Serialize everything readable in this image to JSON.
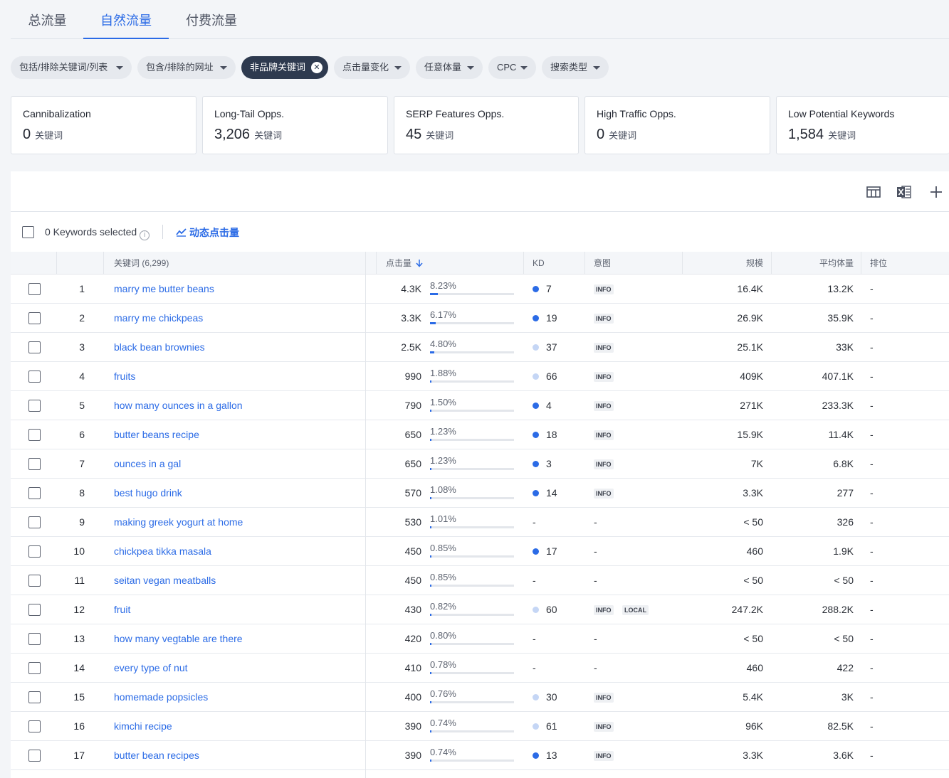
{
  "tabs": [
    {
      "label": "总流量",
      "active": false
    },
    {
      "label": "自然流量",
      "active": true
    },
    {
      "label": "付费流量",
      "active": false
    }
  ],
  "filters": [
    {
      "label": "包括/排除关键词/列表"
    },
    {
      "label": "包含/排除的网址"
    },
    {
      "label": "非品牌关键词",
      "active": true
    },
    {
      "label": "点击量变化"
    },
    {
      "label": "任意体量"
    },
    {
      "label": "CPC"
    },
    {
      "label": "搜索类型"
    }
  ],
  "cards": [
    {
      "title": "Cannibalization",
      "value": "0",
      "unit": "关键词"
    },
    {
      "title": "Long-Tail Opps.",
      "value": "3,206",
      "unit": "关键词"
    },
    {
      "title": "SERP Features Opps.",
      "value": "45",
      "unit": "关键词"
    },
    {
      "title": "High Traffic Opps.",
      "value": "0",
      "unit": "关键词"
    },
    {
      "title": "Low Potential Keywords",
      "value": "1,584",
      "unit": "关键词"
    }
  ],
  "toolbar": {
    "icons": [
      "columns-icon",
      "excel-export-icon",
      "plus-icon"
    ]
  },
  "selection": {
    "text": "0 Keywords selected",
    "info_glyph": "i",
    "dynamic_label": "动态点击量"
  },
  "columns": {
    "keyword": "关键词 (6,299)",
    "clicks": "点击量",
    "kd": "KD",
    "intent": "意图",
    "scale": "规模",
    "avg_volume": "平均体量",
    "rank": "排位"
  },
  "colors": {
    "accent": "#2b6be6",
    "kd_dark": "#2b6be6",
    "kd_light": "#c5d6f5"
  },
  "rows": [
    {
      "n": "1",
      "kw": "marry me butter beans",
      "clicks": "4.3K",
      "pct": "8.23%",
      "share": 0.0823,
      "kd": "7",
      "kd_level": "dark",
      "intent": [
        "INFO"
      ],
      "scale": "16.4K",
      "avg": "13.2K",
      "rank": "-"
    },
    {
      "n": "2",
      "kw": "marry me chickpeas",
      "clicks": "3.3K",
      "pct": "6.17%",
      "share": 0.0617,
      "kd": "19",
      "kd_level": "dark",
      "intent": [
        "INFO"
      ],
      "scale": "26.9K",
      "avg": "35.9K",
      "rank": "-"
    },
    {
      "n": "3",
      "kw": "black bean brownies",
      "clicks": "2.5K",
      "pct": "4.80%",
      "share": 0.048,
      "kd": "37",
      "kd_level": "light",
      "intent": [
        "INFO"
      ],
      "scale": "25.1K",
      "avg": "33K",
      "rank": "-"
    },
    {
      "n": "4",
      "kw": "fruits",
      "clicks": "990",
      "pct": "1.88%",
      "share": 0.0188,
      "kd": "66",
      "kd_level": "light",
      "intent": [
        "INFO"
      ],
      "scale": "409K",
      "avg": "407.1K",
      "rank": "-"
    },
    {
      "n": "5",
      "kw": "how many ounces in a gallon",
      "clicks": "790",
      "pct": "1.50%",
      "share": 0.015,
      "kd": "4",
      "kd_level": "dark",
      "intent": [
        "INFO"
      ],
      "scale": "271K",
      "avg": "233.3K",
      "rank": "-"
    },
    {
      "n": "6",
      "kw": "butter beans recipe",
      "clicks": "650",
      "pct": "1.23%",
      "share": 0.0123,
      "kd": "18",
      "kd_level": "dark",
      "intent": [
        "INFO"
      ],
      "scale": "15.9K",
      "avg": "11.4K",
      "rank": "-"
    },
    {
      "n": "7",
      "kw": "ounces in a gal",
      "clicks": "650",
      "pct": "1.23%",
      "share": 0.0123,
      "kd": "3",
      "kd_level": "dark",
      "intent": [
        "INFO"
      ],
      "scale": "7K",
      "avg": "6.8K",
      "rank": "-"
    },
    {
      "n": "8",
      "kw": "best hugo drink",
      "clicks": "570",
      "pct": "1.08%",
      "share": 0.0108,
      "kd": "14",
      "kd_level": "dark",
      "intent": [
        "INFO"
      ],
      "scale": "3.3K",
      "avg": "277",
      "rank": "-"
    },
    {
      "n": "9",
      "kw": "making greek yogurt at home",
      "clicks": "530",
      "pct": "1.01%",
      "share": 0.0101,
      "kd": "-",
      "kd_level": "none",
      "intent": [],
      "intent_dash": "-",
      "scale": "< 50",
      "avg": "326",
      "rank": "-"
    },
    {
      "n": "10",
      "kw": "chickpea tikka masala",
      "clicks": "450",
      "pct": "0.85%",
      "share": 0.0085,
      "kd": "17",
      "kd_level": "dark",
      "intent": [],
      "intent_dash": "-",
      "scale": "460",
      "avg": "1.9K",
      "rank": "-"
    },
    {
      "n": "11",
      "kw": "seitan vegan meatballs",
      "clicks": "450",
      "pct": "0.85%",
      "share": 0.0085,
      "kd": "-",
      "kd_level": "none",
      "intent": [],
      "intent_dash": "-",
      "scale": "< 50",
      "avg": "< 50",
      "rank": "-"
    },
    {
      "n": "12",
      "kw": "fruit",
      "clicks": "430",
      "pct": "0.82%",
      "share": 0.0082,
      "kd": "60",
      "kd_level": "light",
      "intent": [
        "INFO",
        "LOCAL"
      ],
      "scale": "247.2K",
      "avg": "288.2K",
      "rank": "-"
    },
    {
      "n": "13",
      "kw": "how many vegtable are there",
      "clicks": "420",
      "pct": "0.80%",
      "share": 0.008,
      "kd": "-",
      "kd_level": "none",
      "intent": [],
      "intent_dash": "-",
      "scale": "< 50",
      "avg": "< 50",
      "rank": "-"
    },
    {
      "n": "14",
      "kw": "every type of nut",
      "clicks": "410",
      "pct": "0.78%",
      "share": 0.0078,
      "kd": "-",
      "kd_level": "none",
      "intent": [],
      "intent_dash": "-",
      "scale": "460",
      "avg": "422",
      "rank": "-"
    },
    {
      "n": "15",
      "kw": "homemade popsicles",
      "clicks": "400",
      "pct": "0.76%",
      "share": 0.0076,
      "kd": "30",
      "kd_level": "light",
      "intent": [
        "INFO"
      ],
      "scale": "5.4K",
      "avg": "3K",
      "rank": "-"
    },
    {
      "n": "16",
      "kw": "kimchi recipe",
      "clicks": "390",
      "pct": "0.74%",
      "share": 0.0074,
      "kd": "61",
      "kd_level": "light",
      "intent": [
        "INFO"
      ],
      "scale": "96K",
      "avg": "82.5K",
      "rank": "-"
    },
    {
      "n": "17",
      "kw": "butter bean recipes",
      "clicks": "390",
      "pct": "0.74%",
      "share": 0.0074,
      "kd": "13",
      "kd_level": "dark",
      "intent": [
        "INFO"
      ],
      "scale": "3.3K",
      "avg": "3.6K",
      "rank": "-"
    }
  ]
}
